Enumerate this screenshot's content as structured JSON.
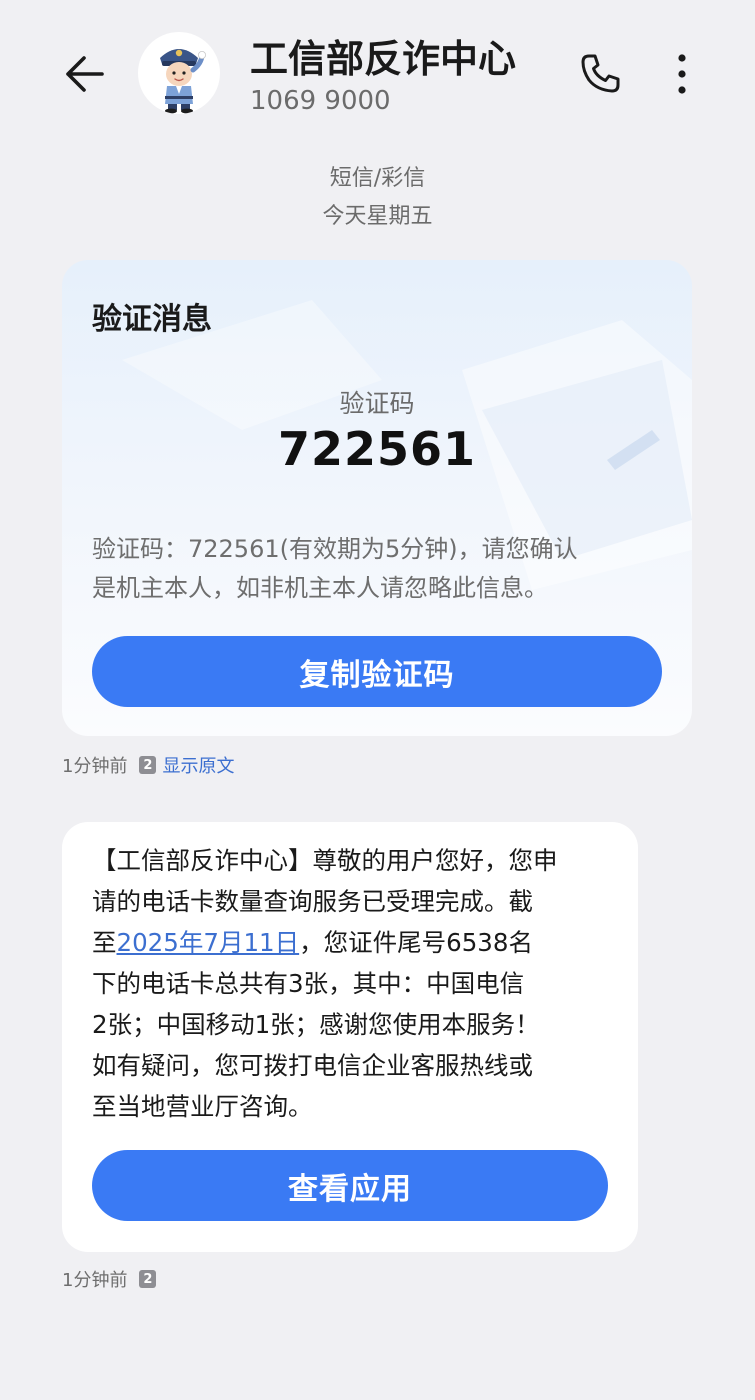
{
  "header": {
    "contact_name": "工信部反诈中心",
    "contact_number": "1069 9000"
  },
  "meta": {
    "message_type": "短信/彩信",
    "date": "今天星期五"
  },
  "verification_card": {
    "title": "验证消息",
    "code_label": "验证码",
    "code": "722561",
    "body_line1": "验证码：722561(有效期为5分钟)，请您确认",
    "body_line2": "是机主本人，如非机主本人请忽略此信息。",
    "copy_button": "复制验证码"
  },
  "verification_meta": {
    "time": "1分钟前",
    "sim": "2",
    "show_original": "显示原文"
  },
  "message": {
    "line1": "【工信部反诈中心】尊敬的用户您好，您申",
    "line2": "请的电话卡数量查询服务已受理完成。截",
    "line3_prefix": "至",
    "line3_link": "2025年7月11日",
    "line3_suffix": "，您证件尾号6538名",
    "line4": "下的电话卡总共有3张，其中：中国电信",
    "line5": "2张；中国移动1张；感谢您使用本服务！",
    "line6": "如有疑问，您可拨打电信企业客服热线或",
    "line7": "至当地营业厅咨询。",
    "view_button": "查看应用"
  },
  "message_meta": {
    "time": "1分钟前",
    "sim": "2"
  },
  "colors": {
    "accent": "#3a7af4",
    "link": "#3c6fd0",
    "background": "#f0f0f3"
  },
  "icons": {
    "back": "arrow-left-icon",
    "call": "phone-icon",
    "more": "more-vertical-icon",
    "avatar": "police-avatar-icon"
  }
}
